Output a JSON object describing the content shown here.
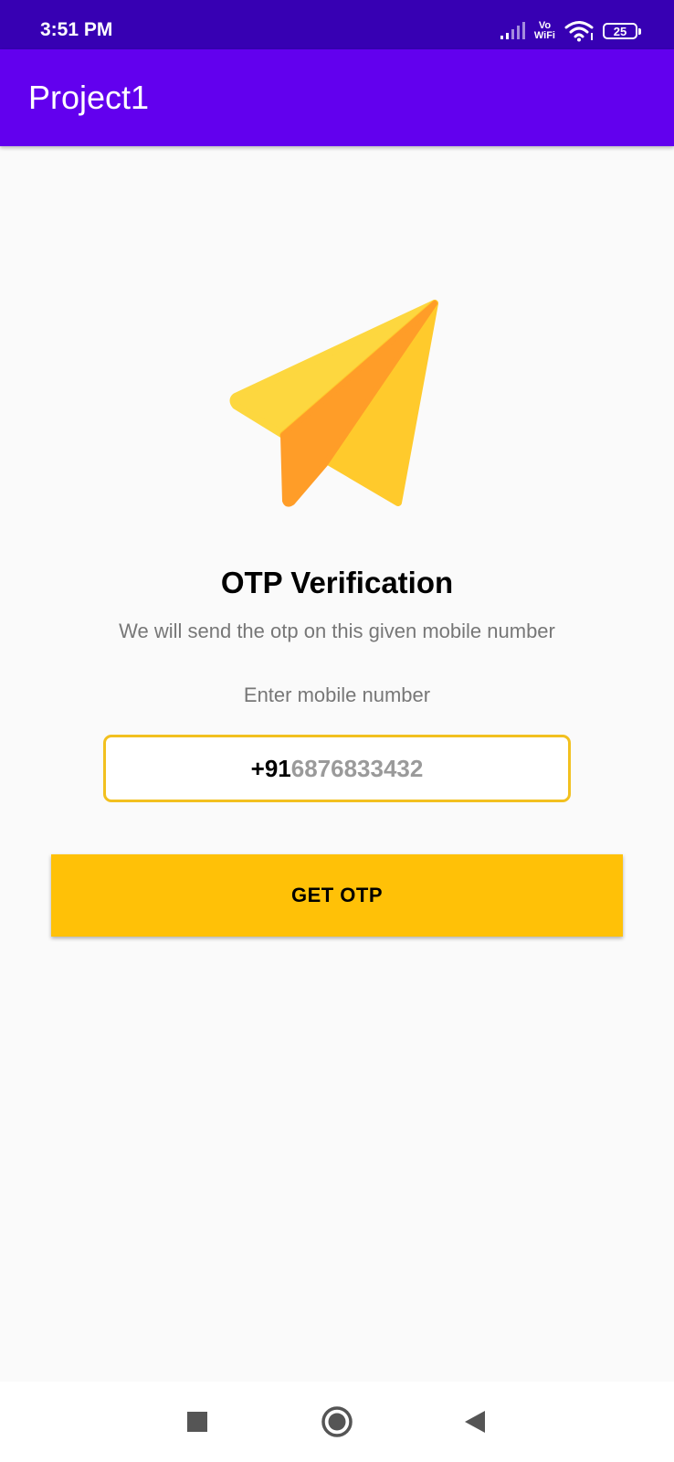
{
  "status_bar": {
    "time": "3:51 PM",
    "network_label_top": "Vo",
    "network_label_bottom": "WiFi",
    "battery_level": "25",
    "icons": [
      "signal-icon",
      "vowifi-icon",
      "wifi-icon",
      "battery-icon"
    ]
  },
  "app_bar": {
    "title": "Project1"
  },
  "main": {
    "illustration": "paper-plane-icon",
    "heading": "OTP Verification",
    "description": "We will send the otp on this given mobile number",
    "input_label": "Enter mobile number",
    "phone_input": {
      "country_code": "+91",
      "number": "6876833432"
    },
    "get_otp_label": "GET OTP"
  },
  "nav_bar": {
    "icons": [
      "recents-square-icon",
      "home-circle-icon",
      "back-triangle-icon"
    ]
  },
  "colors": {
    "status_bar": "#3700b3",
    "app_bar": "#6200ee",
    "accent": "#ffc107",
    "input_border": "#f2c01f",
    "background": "#fafafa"
  }
}
